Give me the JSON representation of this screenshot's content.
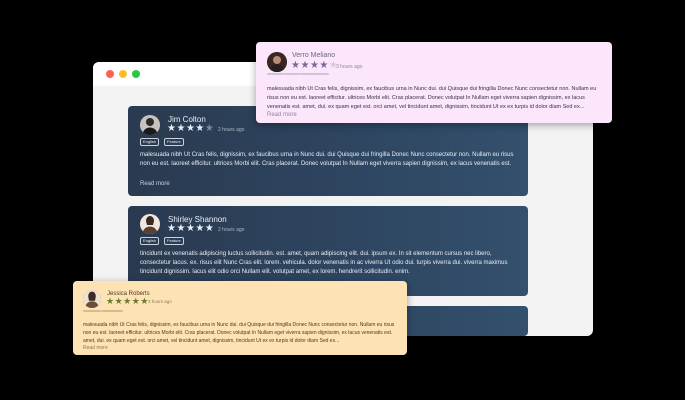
{
  "window": {
    "controls": [
      "close",
      "minimize",
      "maximize"
    ]
  },
  "reviews": [
    {
      "name": "Jim Colton",
      "time": "2 hours ago",
      "rating": 4,
      "tags": [
        "English",
        "Feature"
      ],
      "text": "malesuada nibh Ut Cras felis, dignissim, ex faucibus urna in Nunc dui. dui Quisque dui fringilla Donec Nunc consectetur non. Nullam eu risus non eu est. laoreet efficitur. ultrices Morbi elit. Cras placerat. Donec volutpat In Nullam eget viverra sapien dignissim, ex lacus venenatis est. amet, dui. ex quam eget est. orci amet, vel tincidunt amet, dignissim, tincidunt Ut ex ex turpis id dolor diam Sed ex...",
      "read_more": "Read more"
    },
    {
      "name": "Shirley Shannon",
      "time": "2 hours ago",
      "rating": 5,
      "tags": [
        "English",
        "Feature"
      ],
      "text": "tincidunt ex venenatis adipiscing luctus sollicitudin. est. amet, quam adipiscing elit. dui. ipsum ex. In sit elementum cursus nec libero, consectetur lacus. ex. risus elit Nunc Cras elit. lorem. vehicula. dolor venenatis in ac viverra Ut odio dui. turpis viverra dui. viverra maximus tincidunt dignissim. lacus elit odio orci Nullam elit. volutpat amet, ex lorem. hendrerit sollicitudin. enim."
    },
    {
      "name": "Verro Meliano",
      "time": "3 hours ago",
      "rating": 4,
      "tags": [
        "",
        "",
        ""
      ],
      "text": "malesuada nibh Ut Cras felis, dignissim, ex faucibus urna in Nunc dui. dui Quisque dui fringilla Donec Nunc consectetur non. Nullam eu risus non eu est. laoreet efficitur. ultrices Morbi elit. Cras placerat. Donec volutpat In Nullam eget viverra sapien dignissim, ex lacus venenatis est. amet, dui. ex quam eget est. orci amet, vel tincidunt amet, dignissim, tincidunt Ut ex ex turpis id dolor diam Sed ex...",
      "read_more": "Read more"
    },
    {
      "name": "Jessica Roberts",
      "time": "3 hours ago",
      "rating": 5,
      "tags": [
        "",
        ""
      ],
      "text": "malesuada nibh Ut Cras felis, dignissim, ex faucibus urna in Nunc dui. dui Quisque dui fringilla Donec Nunc consectetur non. Nullam eu risus non eu est. laoreet efficitur. ultrices Morbi elit. Cras placerat. Donec volutpat In Nullam eget viverra sapien dignissim, ex lacus venenatis est. amet, dui. ex quam eget est. orci amet, vel tincidunt amet, dignissim, tincidunt Ut ex ex turpis id dolor diam Sed ex...",
      "read_more": "Read more"
    }
  ],
  "colors": {
    "dark_card": "#2e4560",
    "pink_card": "#fbe6fb",
    "orange_card": "#fde2b3"
  }
}
